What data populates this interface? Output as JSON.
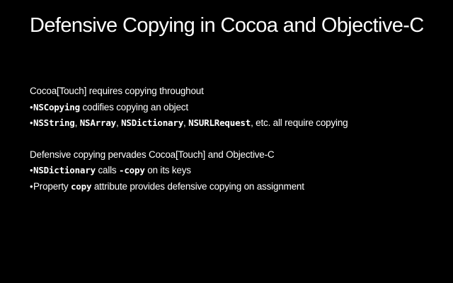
{
  "slide": {
    "title": "Defensive Copying in Cocoa and Objective-C",
    "section1": {
      "heading": "Cocoa[Touch] requires copying throughout",
      "bullet1": {
        "code": "NSCopying",
        "text": " codifies copying an object"
      },
      "bullet2": {
        "code1": "NSString",
        "sep1": ", ",
        "code2": "NSArray",
        "sep2": ", ",
        "code3": "NSDictionary",
        "sep3": ", ",
        "code4": "NSURLRequest",
        "text": ", etc. all require copying"
      }
    },
    "section2": {
      "heading": "Defensive copying pervades Cocoa[Touch] and Objective-C",
      "bullet1": {
        "code1": "NSDictionary",
        "text1": " calls ",
        "code2": "-copy",
        "text2": " on its keys"
      },
      "bullet2": {
        "text1": "Property ",
        "code": "copy",
        "text2": " attribute provides defensive copying on assignment"
      }
    },
    "bullet_glyph": "•"
  }
}
